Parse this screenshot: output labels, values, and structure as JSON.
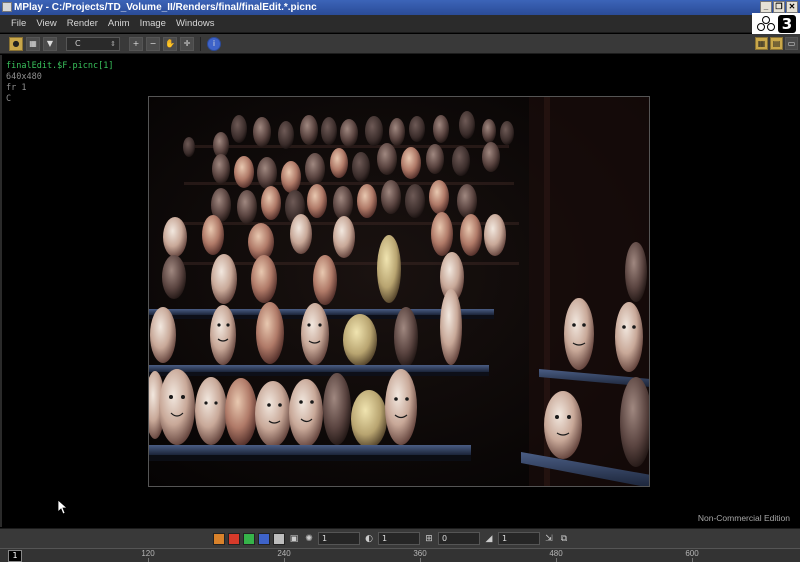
{
  "window": {
    "title": "MPlay - C:/Projects/TD_Volume_II/Renders/final/finalEdit.*.picnc",
    "buttons": [
      "_",
      "❐",
      "✕"
    ]
  },
  "menu": [
    "File",
    "View",
    "Render",
    "Anim",
    "Image",
    "Windows"
  ],
  "logo": {
    "digit": "3"
  },
  "toolbar": {
    "channel": "C",
    "icons": [
      "view-icon",
      "zoom-in-icon",
      "zoom-out-icon",
      "hand-icon",
      "crosshair-icon",
      "info-icon"
    ],
    "right_icons": [
      "grid-icon",
      "layout-icon",
      "pane-icon"
    ]
  },
  "image_info": {
    "filename": "finalEdit.$F.picnc[1]",
    "resolution": "640x480",
    "frame": "fr 1",
    "channel": "C"
  },
  "render": {
    "description_colors": {
      "shelf": "#3a4a6a",
      "egg": "#d8c8b8",
      "background": "#0a0706"
    }
  },
  "edition_label": "Non-Commercial Edition",
  "playbar": {
    "color_swatches": [
      "#d9822b",
      "#d63a2a",
      "#36b34a",
      "#3e63c9",
      "#bdbdbd"
    ],
    "gamma": "1",
    "exposure": "1",
    "offset": "0",
    "step": "1"
  },
  "timeline": {
    "current_frame": "1",
    "ticks": [
      "120",
      "240",
      "360",
      "480",
      "600"
    ]
  }
}
